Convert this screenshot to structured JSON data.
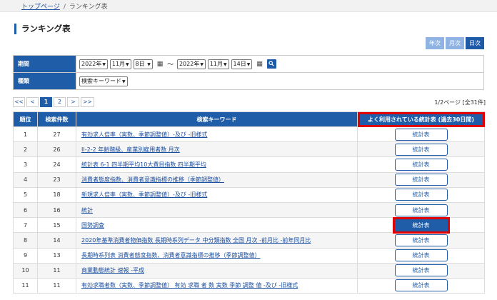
{
  "breadcrumb": {
    "home": "トップページ",
    "separator": "/",
    "current": "ランキング表"
  },
  "page_title": "ランキング表",
  "period_tabs": [
    {
      "label": "年次",
      "active": false
    },
    {
      "label": "月次",
      "active": false
    },
    {
      "label": "日次",
      "active": true
    }
  ],
  "conditions": {
    "period_label": "期間",
    "from": {
      "year": "2022年",
      "month": "11月",
      "day": "8日"
    },
    "tilde": "～",
    "to": {
      "year": "2022年",
      "month": "11月",
      "day": "14日"
    },
    "type_label": "種類",
    "type_value": "検索キーワード"
  },
  "pager": {
    "first": "<<",
    "prev": "<",
    "page1": "1",
    "page2": "2",
    "next": ">",
    "last": ">>"
  },
  "page_info": "1/2ページ [全31件]",
  "table": {
    "headers": {
      "rank": "順位",
      "count": "検索件数",
      "keyword": "検索キーワード",
      "stats": "よく利用されている統計表 (過去30日間)"
    },
    "button_label": "統計表",
    "rows": [
      {
        "rank": "1",
        "count": "27",
        "keyword": "有効求人倍率（実数、季節調整値）-及び -旧様式"
      },
      {
        "rank": "2",
        "count": "26",
        "keyword": "II-2-2 年齢階級、産業別雇用者数 月次"
      },
      {
        "rank": "3",
        "count": "24",
        "keyword": "統計表 6-1 四半期平均10大費目指数 四半期平均"
      },
      {
        "rank": "4",
        "count": "23",
        "keyword": "消費者態度指数、消費者意識指標の推移（季節調整値）"
      },
      {
        "rank": "5",
        "count": "18",
        "keyword": "新規求人倍率（実数、季節調整値）-及び -旧様式"
      },
      {
        "rank": "6",
        "count": "16",
        "keyword": "統計"
      },
      {
        "rank": "7",
        "count": "15",
        "keyword": "国勢調査"
      },
      {
        "rank": "8",
        "count": "14",
        "keyword": "2020年基準消費者物価指数 長期時系列データ 中分類指数 全国 月次 -前月比 -前年同月比"
      },
      {
        "rank": "9",
        "count": "13",
        "keyword": "長期時系列表 消費者態度指数、消費者意識指標の推移（季節調整値）"
      },
      {
        "rank": "10",
        "count": "11",
        "keyword": "商業動態統計 速報 -平成"
      },
      {
        "rank": "11",
        "count": "11",
        "keyword": "有効求職者数（実数、季節調整値） 有効 求職 者 数 実数 季節 調整 値 -及び -旧様式"
      }
    ]
  },
  "colors": {
    "primary": "#1f5da8",
    "highlight": "#e00000",
    "tab_inactive": "#8fb4e3"
  }
}
